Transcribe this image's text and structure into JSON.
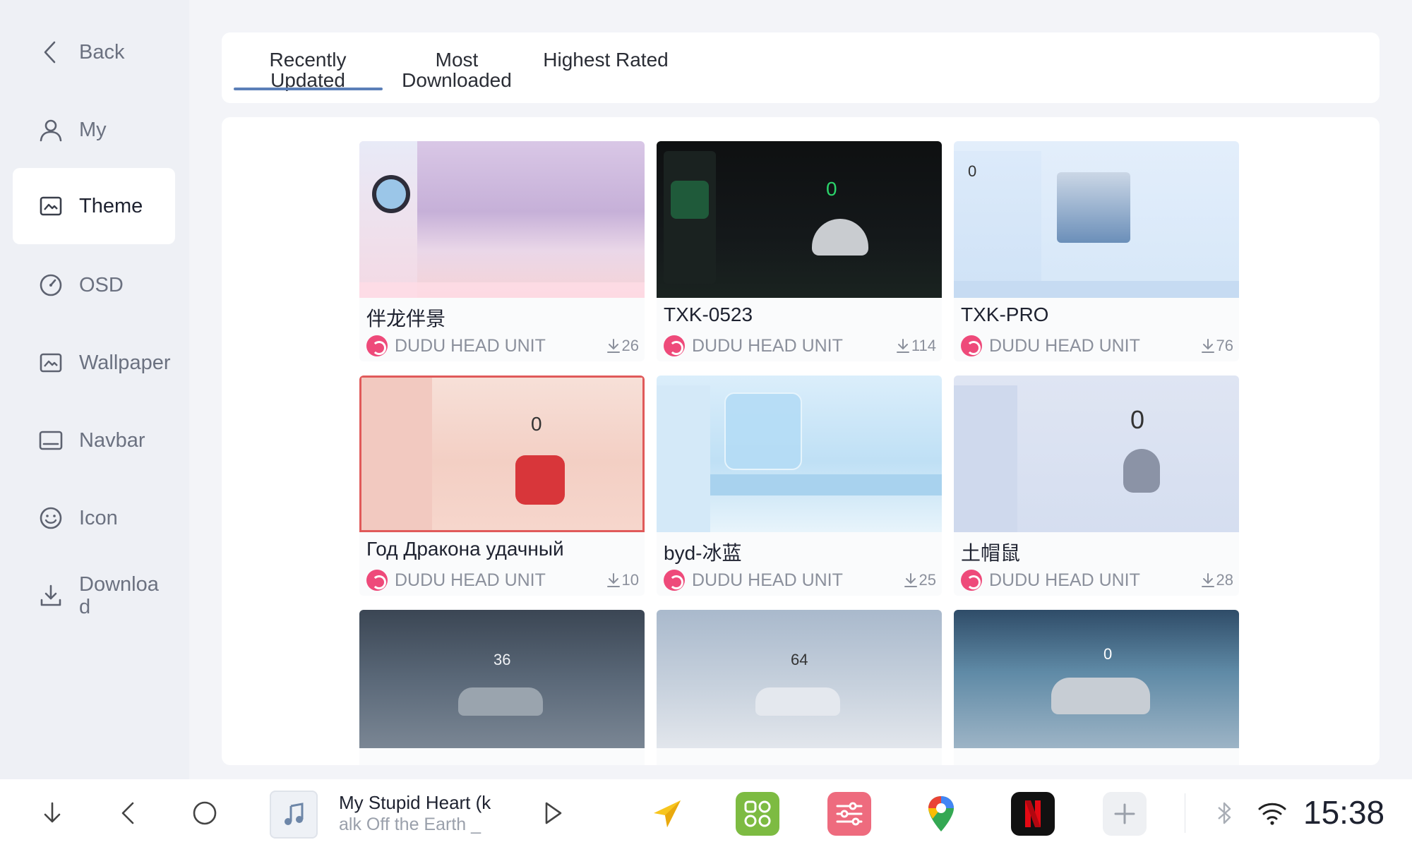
{
  "sidebar": {
    "items": [
      {
        "label": "Back"
      },
      {
        "label": "My"
      },
      {
        "label": "Theme"
      },
      {
        "label": "OSD"
      },
      {
        "label": "Wallpaper"
      },
      {
        "label": "Navbar"
      },
      {
        "label": "Icon"
      },
      {
        "label": "Downloa d"
      }
    ],
    "active": "Theme"
  },
  "tabs": [
    {
      "label": "Recently Updated"
    },
    {
      "label": "Most Downloaded"
    },
    {
      "label": "Highest Rated"
    }
  ],
  "themes": [
    {
      "title": "伴龙伴景",
      "author": "DUDU HEAD UNIT",
      "downloads": "26",
      "preview": ""
    },
    {
      "title": "TXK-0523",
      "author": "DUDU HEAD UNIT",
      "downloads": "114",
      "preview": "0"
    },
    {
      "title": "TXK-PRO",
      "author": "DUDU HEAD UNIT",
      "downloads": "76",
      "preview": "0"
    },
    {
      "title": "Год Дракона удачный",
      "author": "DUDU HEAD UNIT",
      "downloads": "10",
      "preview": "0"
    },
    {
      "title": "byd-冰蓝",
      "author": "DUDU HEAD UNIT",
      "downloads": "25",
      "preview": ""
    },
    {
      "title": "土帽鼠",
      "author": "DUDU HEAD UNIT",
      "downloads": "28",
      "preview": "0"
    },
    {
      "title": "",
      "author": "",
      "downloads": "",
      "preview": "36"
    },
    {
      "title": "",
      "author": "",
      "downloads": "",
      "preview": "64"
    },
    {
      "title": "",
      "author": "",
      "downloads": "",
      "preview": "0"
    }
  ],
  "media": {
    "title": "My Stupid Heart (k",
    "subtitle": "alk Off the Earth _"
  },
  "status": {
    "time": "15:38"
  },
  "colors": {
    "accent": "#5b7fb8",
    "brand_logo": "#ee4a7a"
  }
}
